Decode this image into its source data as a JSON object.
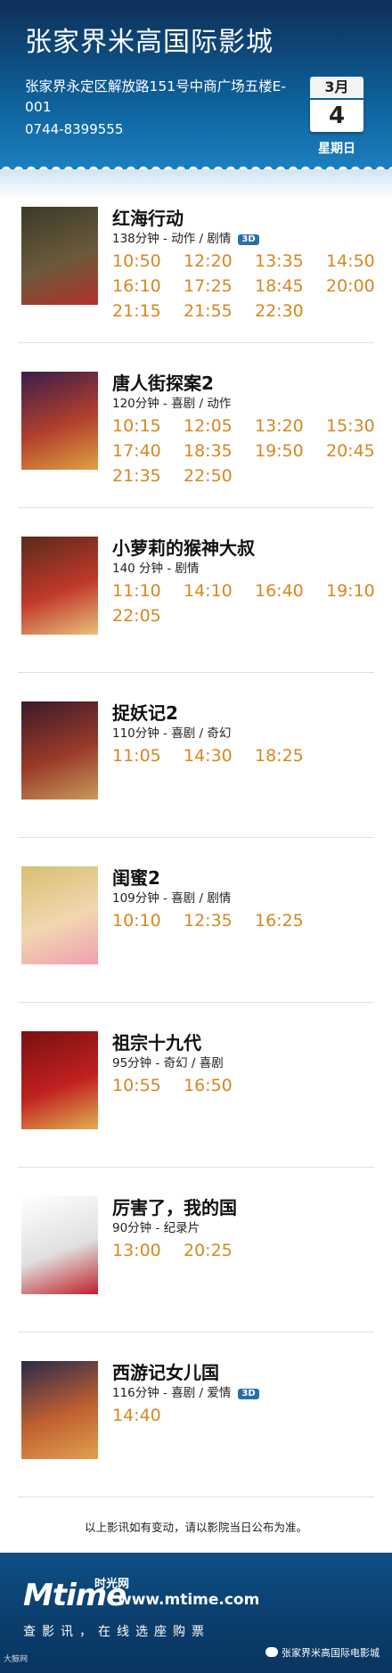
{
  "cinema": {
    "name": "张家界米高国际影城",
    "address": "张家界永定区解放路151号中商广场五楼E-001",
    "phone": "0744-8399555"
  },
  "date": {
    "month": "3月",
    "day": "4",
    "weekday": "星期日"
  },
  "movies": [
    {
      "title": "红海行动",
      "meta": "138分钟 - 动作 / 剧情",
      "is3d": true,
      "times": [
        "10:50",
        "12:20",
        "13:35",
        "14:50",
        "16:10",
        "17:25",
        "18:45",
        "20:00",
        "21:15",
        "21:55",
        "22:30"
      ]
    },
    {
      "title": "唐人街探案2",
      "meta": "120分钟 - 喜剧 / 动作",
      "is3d": false,
      "times": [
        "10:15",
        "12:05",
        "13:20",
        "15:30",
        "17:40",
        "18:35",
        "19:50",
        "20:45",
        "21:35",
        "22:50"
      ]
    },
    {
      "title": "小萝莉的猴神大叔",
      "meta": "140 分钟 - 剧情",
      "is3d": false,
      "times": [
        "11:10",
        "14:10",
        "16:40",
        "19:10",
        "22:05"
      ]
    },
    {
      "title": "捉妖记2",
      "meta": "110分钟 - 喜剧 / 奇幻",
      "is3d": false,
      "times": [
        "11:05",
        "14:30",
        "18:25"
      ]
    },
    {
      "title": "闺蜜2",
      "meta": "109分钟 - 喜剧 / 剧情",
      "is3d": false,
      "times": [
        "10:10",
        "12:35",
        "16:25"
      ]
    },
    {
      "title": "祖宗十九代",
      "meta": "95分钟 - 奇幻 / 喜剧",
      "is3d": false,
      "times": [
        "10:55",
        "16:50"
      ]
    },
    {
      "title": "厉害了，我的国",
      "meta": "90分钟 - 纪录片",
      "is3d": false,
      "times": [
        "13:00",
        "20:25"
      ]
    },
    {
      "title": "西游记女儿国",
      "meta": "116分钟 - 喜剧 / 爱情",
      "is3d": true,
      "times": [
        "14:40"
      ]
    }
  ],
  "badge3d_label": "3D",
  "notice": "以上影讯如有变动，请以影院当日公布为准。",
  "footer": {
    "logo": "Mtime",
    "logo_cn": "时光网",
    "url": "www.mtime.com",
    "slogan": "查影讯，在线选座购票",
    "wechat": "张家界米高国际电影城",
    "watermark": "大鲸网"
  },
  "poster_colors": [
    [
      "#3a3a2a",
      "#6b5a3a",
      "#b0322a"
    ],
    [
      "#3b1d4a",
      "#b2402e",
      "#e0a040"
    ],
    [
      "#5a2a1a",
      "#c0392b",
      "#e8c07a"
    ],
    [
      "#3a1a2a",
      "#9a3a2a",
      "#c89a5a"
    ],
    [
      "#d8c070",
      "#f2d6b0",
      "#f0a0b0"
    ],
    [
      "#7a1010",
      "#c02020",
      "#e0b050"
    ],
    [
      "#ffffff",
      "#e0e0e0",
      "#c0202a"
    ],
    [
      "#2a2a4a",
      "#c06030",
      "#e0a050"
    ]
  ]
}
